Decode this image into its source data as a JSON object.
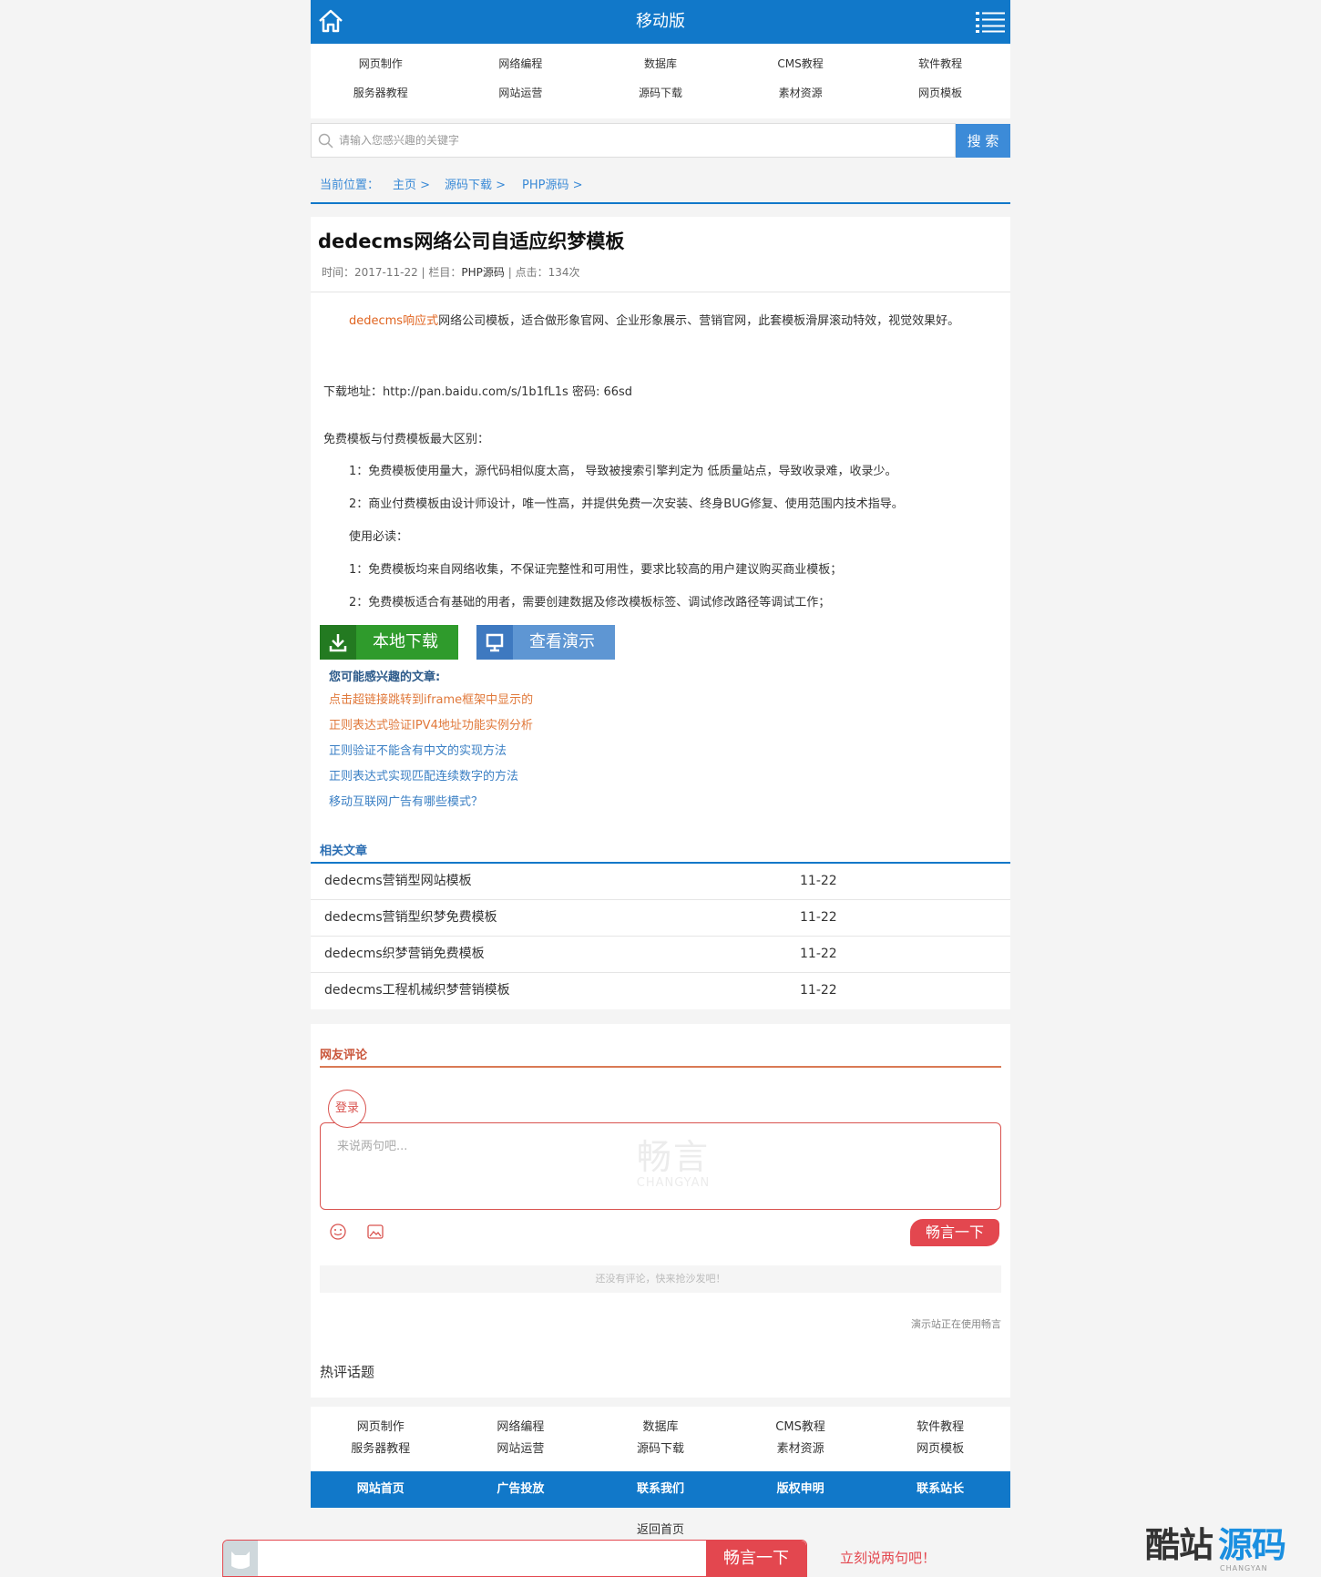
{
  "header": {
    "title": "移动版"
  },
  "category_nav": [
    "网页制作",
    "网络编程",
    "数据库",
    "CMS教程",
    "软件教程",
    "服务器教程",
    "网站运营",
    "源码下载",
    "素材资源",
    "网页模板"
  ],
  "search": {
    "placeholder": "请输入您感兴趣的关键字",
    "button": "搜 索"
  },
  "breadcrumb": [
    "当前位置：",
    "主页 >",
    "源码下载 >",
    "PHP源码 >"
  ],
  "article": {
    "title": "dedecms网络公司自适应织梦模板",
    "meta_prefix": "时间：2017-11-22 | 栏目：",
    "meta_column": "PHP源码",
    "meta_suffix": " | 点击：134次",
    "intro_link": "dedecms响应式",
    "intro_text": "网络公司模板，适合做形象官网、企业形象展示、营销官网，此套模板滑屏滚动特效，视觉效果好。",
    "download_addr": "下载地址：http://pan.baidu.com/s/1b1fL1s 密码: 66sd",
    "diff_title": "免费模板与付费模板最大区别：",
    "diff_items": [
      "1：免费模板使用量大，源代码相似度太高， 导致被搜索引擎判定为 低质量站点，导致收录难，收录少。",
      "2：商业付费模板由设计师设计，唯一性高，并提供免费一次安装、终身BUG修复、使用范围内技术指导。",
      "使用必读：",
      "1：免费模板均来自网络收集，不保证完整性和可用性，要求比较高的用户建议购买商业模板；",
      "2：免费模板适合有基础的用者，需要创建数据及修改模板标签、调试修改路径等调试工作；"
    ],
    "btn_download": "本地下载",
    "btn_demo": "查看演示"
  },
  "interest": {
    "title": "您可能感兴趣的文章:",
    "items": [
      "点击超链接跳转到iframe框架中显示的",
      "正则表达式验证IPV4地址功能实例分析",
      "正则验证不能含有中文的实现方法",
      "正则表达式实现匹配连续数字的方法",
      "移动互联网广告有哪些模式？"
    ]
  },
  "related": {
    "title": "相关文章",
    "items": [
      {
        "title": "dedecms营销型网站模板",
        "date": "11-22"
      },
      {
        "title": "dedecms营销型织梦免费模板",
        "date": "11-22"
      },
      {
        "title": "dedecms织梦营销免费模板",
        "date": "11-22"
      },
      {
        "title": "dedecms工程机械织梦营销模板",
        "date": "11-22"
      }
    ]
  },
  "comments": {
    "title": "网友评论",
    "login": "登录",
    "placeholder": "来说两句吧...",
    "watermark_cn": "畅言",
    "watermark_en": "CHANGYAN",
    "submit": "畅言一下",
    "empty": "还没有评论，快来抢沙发吧！",
    "powered": "演示站正在使用畅言",
    "hot_topic": "热评话题"
  },
  "footer_nav": [
    "网页制作",
    "网络编程",
    "数据库",
    "CMS教程",
    "软件教程",
    "服务器教程",
    "网站运营",
    "源码下载",
    "素材资源",
    "网页模板"
  ],
  "footer_bar": [
    "网站首页",
    "广告投放",
    "联系我们",
    "版权申明",
    "联系站长"
  ],
  "back_home": "返回首页",
  "changyan_bar": {
    "button": "畅言一下",
    "cta": "立刻说两句吧！"
  },
  "site_logo": {
    "part1": "酷站",
    "part2": "源码",
    "sub": "CHANGYAN"
  },
  "colors": {
    "brand_blue": "#1178c9",
    "accent_red": "#e3474f",
    "download_green": "#2f9b2c"
  }
}
